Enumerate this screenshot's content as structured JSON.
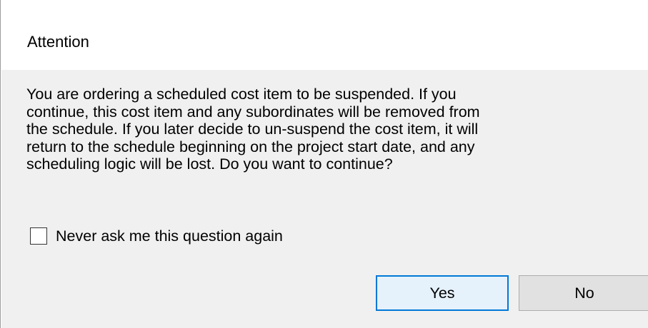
{
  "dialog": {
    "title": "Attention",
    "message_lines": [
      "You are ordering a scheduled cost item to be suspended.  If you",
      "continue, this cost item and any subordinates will be removed from",
      "the schedule.  If you later decide to un-suspend the cost item, it will",
      "return to the schedule beginning on the project start date, and any",
      "scheduling logic will be lost.  Do you want to continue?"
    ],
    "checkbox": {
      "label": "Never ask me this question again",
      "checked": false
    },
    "buttons": {
      "yes_label": "Yes",
      "no_label": "No"
    }
  },
  "colors": {
    "body_background": "#f0f0f0",
    "default_button_border": "#0078d7",
    "default_button_fill": "#e5f1fb",
    "button_fill": "#e1e1e1"
  }
}
